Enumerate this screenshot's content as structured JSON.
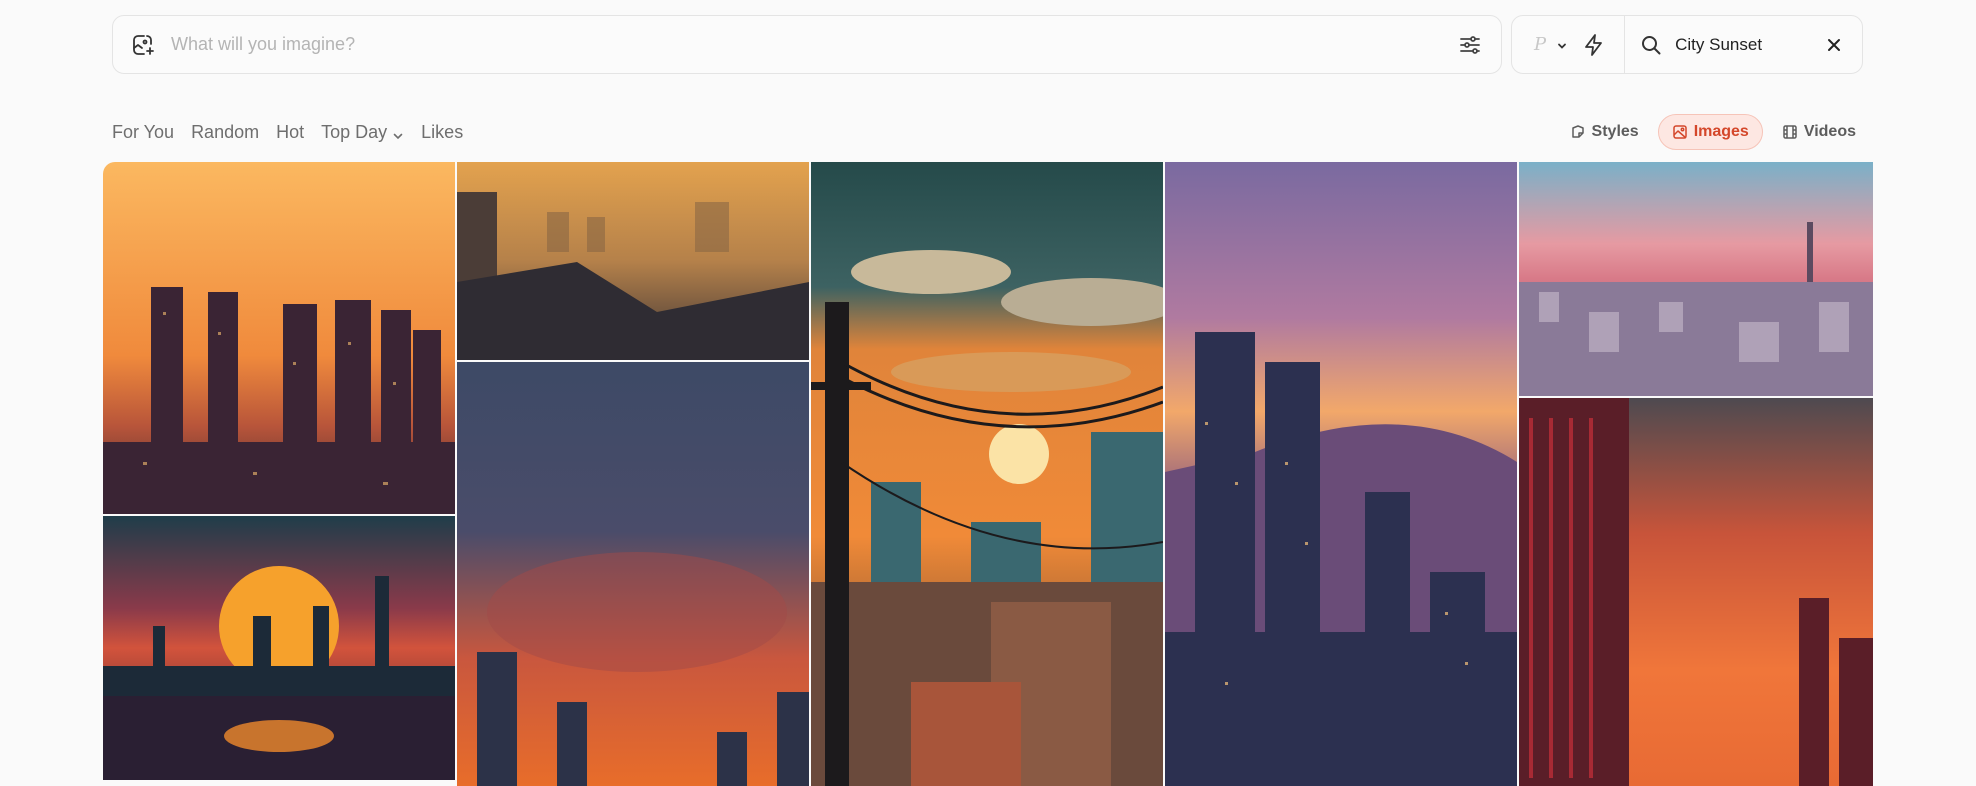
{
  "prompt": {
    "placeholder": "What will you imagine?"
  },
  "model": {
    "label": "P"
  },
  "search": {
    "value": "City Sunset"
  },
  "feed_tabs": [
    {
      "label": "For You"
    },
    {
      "label": "Random"
    },
    {
      "label": "Hot"
    },
    {
      "label": "Top Day"
    },
    {
      "label": "Likes"
    }
  ],
  "content_types": [
    {
      "label": "Styles",
      "icon": "brush-icon"
    },
    {
      "label": "Images",
      "icon": "image-icon",
      "active": true
    },
    {
      "label": "Videos",
      "icon": "film-icon"
    }
  ],
  "colors": {
    "accent": "#d4472a",
    "accent_bg": "#fde7e2",
    "muted_text": "#6e6e6e"
  },
  "gallery": [
    {
      "name": "orange-skyline-towers"
    },
    {
      "name": "hazy-golden-rooftops"
    },
    {
      "name": "pixel-powerlines-sunset"
    },
    {
      "name": "purple-dusk-skyscrapers"
    },
    {
      "name": "pink-sky-tower-panorama"
    },
    {
      "name": "synthwave-sun-reflection"
    },
    {
      "name": "blue-orange-cloud-sky"
    },
    {
      "name": "red-clouds-dark-towers"
    }
  ]
}
